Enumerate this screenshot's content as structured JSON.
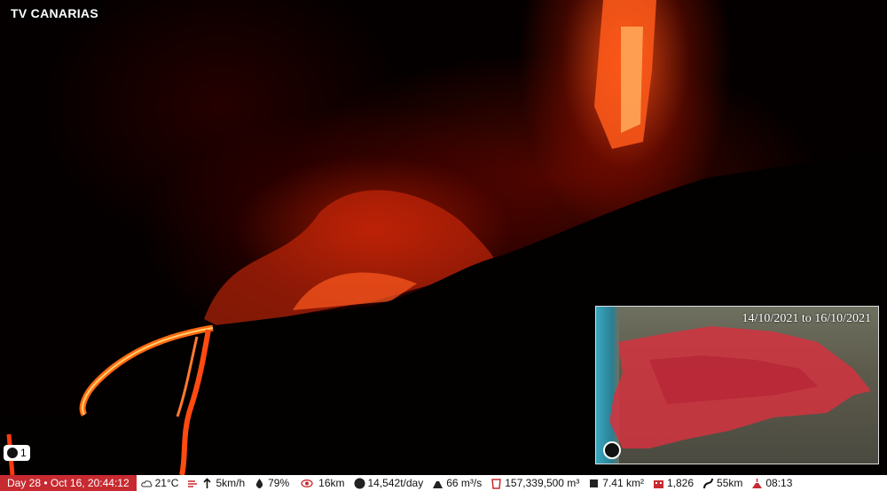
{
  "broadcast": {
    "channel": "TV CANARIAS"
  },
  "counter": {
    "value": "1"
  },
  "map": {
    "date_range": "14/10/2021 to 16/10/2021"
  },
  "status_bar": {
    "day": "Day 28 • Oct 16, 20:44:12",
    "temperature": "21°C",
    "wind": "5km/h",
    "humidity": "79%",
    "visibility": "16km",
    "so2": "14,542t/day",
    "lava_flow": "66 m³/s",
    "lava_volume": "157,339,500 m³",
    "area": "7.41 km²",
    "buildings": "1,826",
    "road": "55km",
    "time": "08:13"
  },
  "colors": {
    "accent": "#c72a30",
    "lava": "#ff4a10"
  }
}
